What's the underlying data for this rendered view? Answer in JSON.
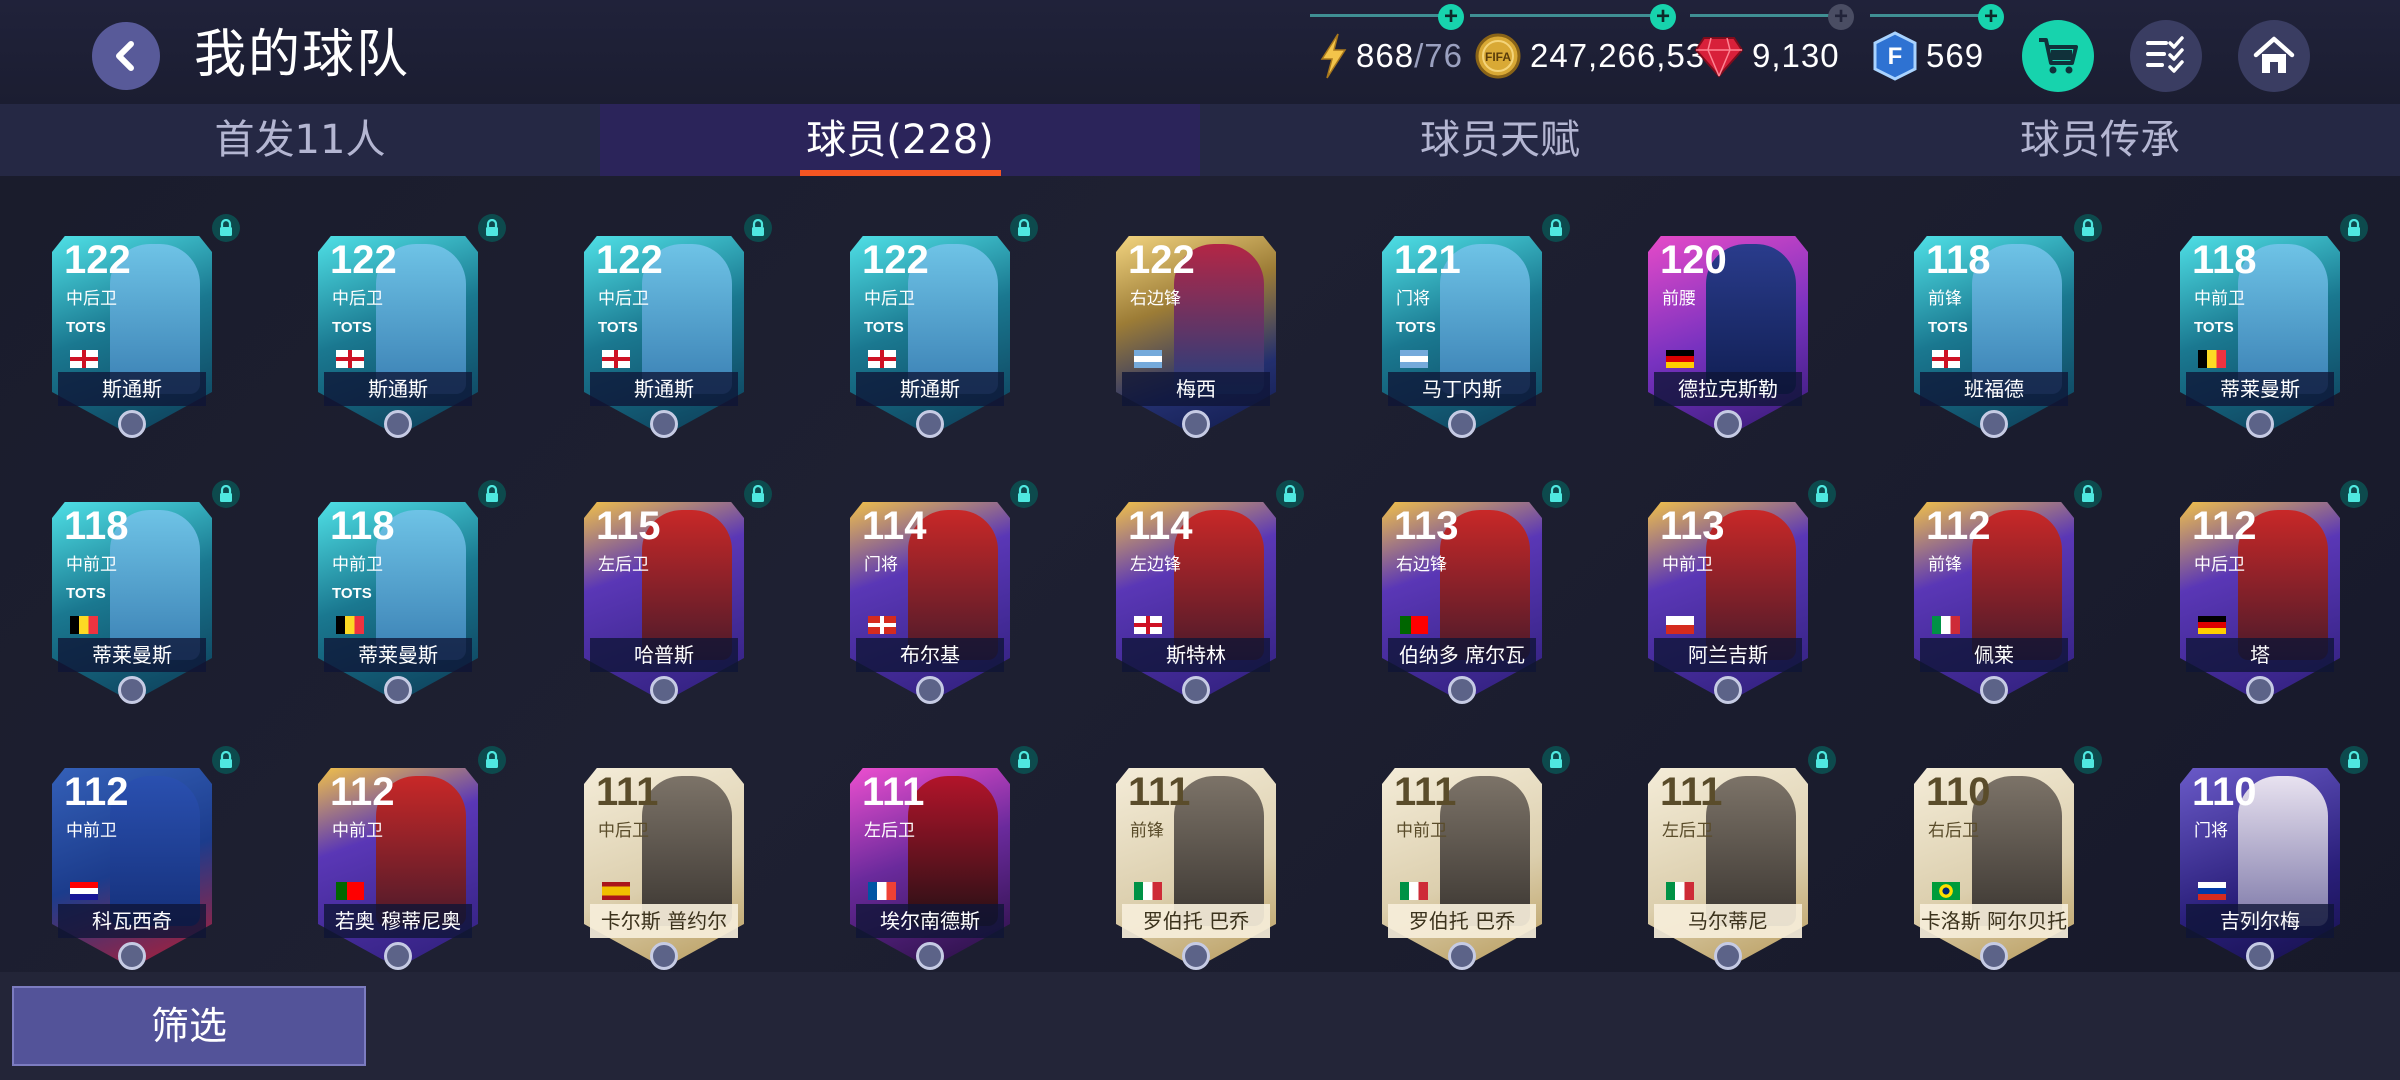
{
  "header": {
    "title": "我的球队",
    "back_icon": "back-arrow-icon",
    "resources": {
      "energy": {
        "icon": "lightning-icon",
        "value": "868",
        "max": "/76"
      },
      "coins": {
        "icon": "fifa-coin-icon",
        "coin_text": "FIFA",
        "value": "247,266,539"
      },
      "gems": {
        "icon": "ruby-gem-icon",
        "value": "9,130"
      },
      "fifa_points": {
        "icon": "fifa-points-icon",
        "letter": "F",
        "value": "569"
      }
    },
    "buttons": {
      "shop": "cart-icon",
      "tasks": "checklist-icon",
      "home": "home-icon"
    },
    "colors": {
      "shop_bg": "#17d3ad",
      "icon_button_bg": "#3a3d62"
    }
  },
  "tabs": [
    {
      "label": "首发11人",
      "active": false
    },
    {
      "label": "球员(228)",
      "active": true
    },
    {
      "label": "球员天赋",
      "active": false
    },
    {
      "label": "球员传承",
      "active": false
    }
  ],
  "cards": [
    {
      "rating": "122",
      "position": "中后卫",
      "badge": "TOTS",
      "name": "斯通斯",
      "flag": "england",
      "theme": "tots",
      "locked": true
    },
    {
      "rating": "122",
      "position": "中后卫",
      "badge": "TOTS",
      "name": "斯通斯",
      "flag": "england",
      "theme": "tots",
      "locked": true
    },
    {
      "rating": "122",
      "position": "中后卫",
      "badge": "TOTS",
      "name": "斯通斯",
      "flag": "england",
      "theme": "tots",
      "locked": true
    },
    {
      "rating": "122",
      "position": "中后卫",
      "badge": "TOTS",
      "name": "斯通斯",
      "flag": "england",
      "theme": "tots",
      "locked": true
    },
    {
      "rating": "122",
      "position": "右边锋",
      "badge": "",
      "name": "梅西",
      "flag": "argentina",
      "theme": "gold",
      "locked": false
    },
    {
      "rating": "121",
      "position": "门将",
      "badge": "TOTS",
      "name": "马丁内斯",
      "flag": "argentina",
      "theme": "tots",
      "locked": true
    },
    {
      "rating": "120",
      "position": "前腰",
      "badge": "",
      "name": "德拉克斯勒",
      "flag": "germany",
      "theme": "purple",
      "locked": false
    },
    {
      "rating": "118",
      "position": "前锋",
      "badge": "TOTS",
      "name": "班福德",
      "flag": "england",
      "theme": "tots",
      "locked": true
    },
    {
      "rating": "118",
      "position": "中前卫",
      "badge": "TOTS",
      "name": "蒂莱曼斯",
      "flag": "belgium",
      "theme": "tots",
      "locked": true
    },
    {
      "rating": "118",
      "position": "中前卫",
      "badge": "TOTS",
      "name": "蒂莱曼斯",
      "flag": "belgium",
      "theme": "tots",
      "locked": true
    },
    {
      "rating": "118",
      "position": "中前卫",
      "badge": "TOTS",
      "name": "蒂莱曼斯",
      "flag": "belgium",
      "theme": "tots",
      "locked": true
    },
    {
      "rating": "115",
      "position": "左后卫",
      "badge": "",
      "name": "哈普斯",
      "flag": "",
      "theme": "fest",
      "locked": true
    },
    {
      "rating": "114",
      "position": "门将",
      "badge": "",
      "name": "布尔基",
      "flag": "switzerland",
      "theme": "fest",
      "locked": true
    },
    {
      "rating": "114",
      "position": "左边锋",
      "badge": "",
      "name": "斯特林",
      "flag": "england",
      "theme": "fest",
      "locked": true
    },
    {
      "rating": "113",
      "position": "右边锋",
      "badge": "",
      "name": "伯纳多 席尔瓦",
      "flag": "portugal",
      "theme": "fest",
      "locked": true
    },
    {
      "rating": "113",
      "position": "中前卫",
      "badge": "",
      "name": "阿兰吉斯",
      "flag": "chile",
      "theme": "fest",
      "locked": true
    },
    {
      "rating": "112",
      "position": "前锋",
      "badge": "",
      "name": "佩莱",
      "flag": "italy",
      "theme": "fest",
      "locked": true
    },
    {
      "rating": "112",
      "position": "中后卫",
      "badge": "",
      "name": "塔",
      "flag": "germany",
      "theme": "fest",
      "locked": true
    },
    {
      "rating": "112",
      "position": "中前卫",
      "badge": "",
      "name": "科瓦西奇",
      "flag": "croatia",
      "theme": "blue",
      "locked": true
    },
    {
      "rating": "112",
      "position": "中前卫",
      "badge": "",
      "name": "若奥 穆蒂尼奥",
      "flag": "portugal",
      "theme": "fest",
      "locked": true
    },
    {
      "rating": "111",
      "position": "中后卫",
      "badge": "",
      "name": "卡尔斯 普约尔",
      "flag": "spain",
      "theme": "icon",
      "locked": false
    },
    {
      "rating": "111",
      "position": "左后卫",
      "badge": "",
      "name": "埃尔南德斯",
      "flag": "france",
      "theme": "mil",
      "locked": true
    },
    {
      "rating": "111",
      "position": "前锋",
      "badge": "",
      "name": "罗伯托 巴乔",
      "flag": "italy",
      "theme": "icon",
      "locked": false
    },
    {
      "rating": "111",
      "position": "中前卫",
      "badge": "",
      "name": "罗伯托 巴乔",
      "flag": "italy",
      "theme": "icon",
      "locked": true
    },
    {
      "rating": "111",
      "position": "左后卫",
      "badge": "",
      "name": "马尔蒂尼",
      "flag": "italy",
      "theme": "icon",
      "locked": true
    },
    {
      "rating": "110",
      "position": "右后卫",
      "badge": "",
      "name": "卡洛斯 阿尔贝托",
      "flag": "brazil",
      "theme": "icon",
      "locked": true
    },
    {
      "rating": "110",
      "position": "门将",
      "badge": "",
      "name": "吉列尔梅",
      "flag": "russia",
      "theme": "ucl",
      "locked": true
    }
  ],
  "footer": {
    "filter_label": "筛选"
  }
}
